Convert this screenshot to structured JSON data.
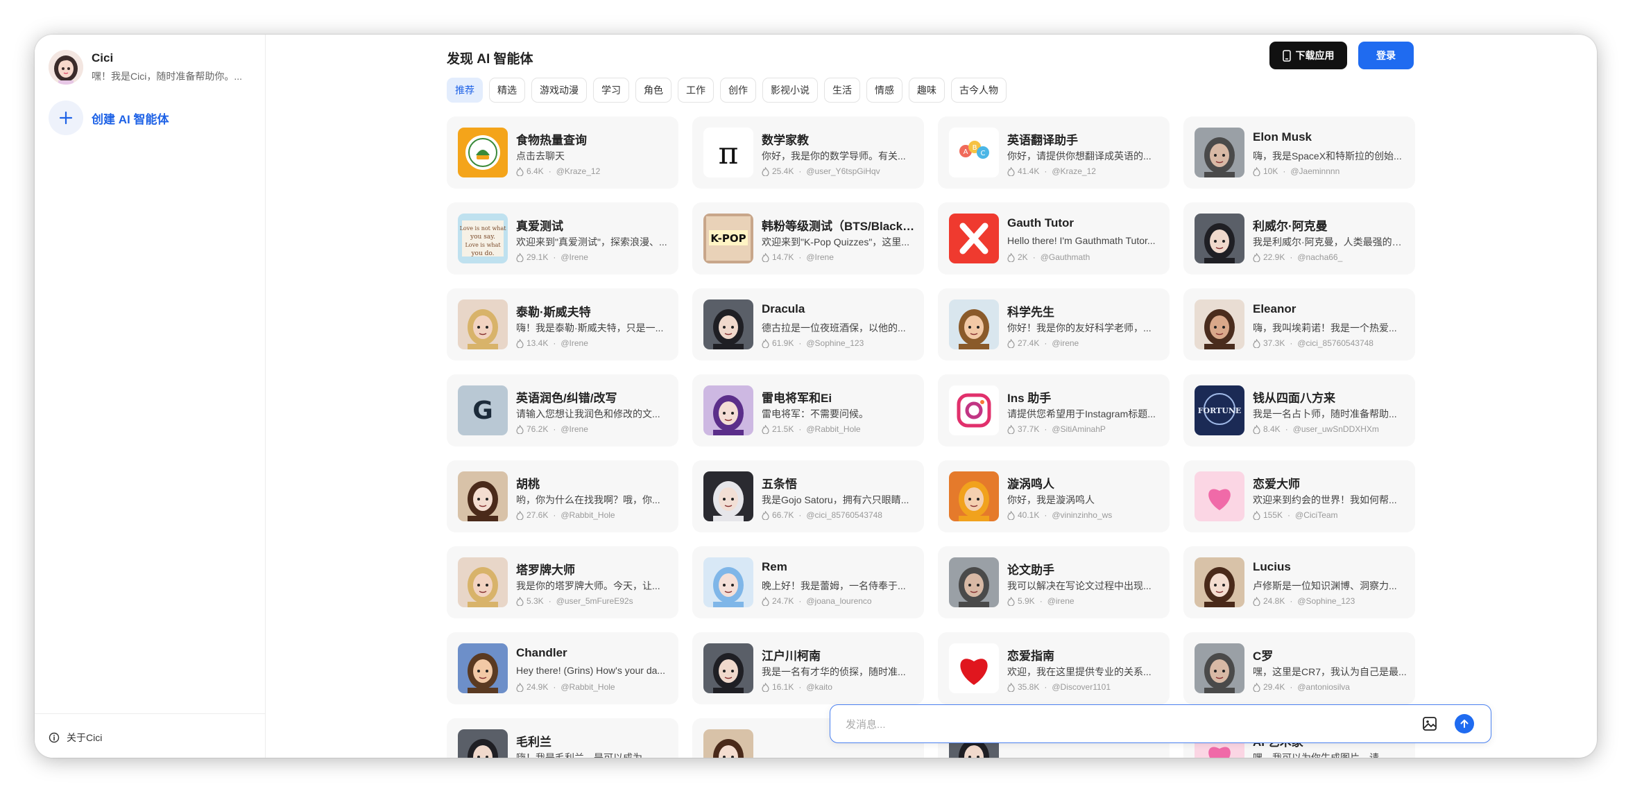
{
  "sidebar": {
    "profile": {
      "name": "Cici",
      "desc": "嘿！我是Cici，随时准备帮助你。..."
    },
    "create_label": "创建 AI 智能体",
    "about_label": "关于Cici"
  },
  "header": {
    "title": "发现 AI 智能体",
    "download_label": "下载应用",
    "login_label": "登录"
  },
  "tabs": [
    "推荐",
    "精选",
    "游戏动漫",
    "学习",
    "角色",
    "工作",
    "创作",
    "影视小说",
    "生活",
    "情感",
    "趣味",
    "古今人物"
  ],
  "cards": [
    {
      "name": "食物热量查询",
      "desc": "点击去聊天",
      "count": "6.4K",
      "author": "@Kraze_12",
      "avatar": "food"
    },
    {
      "name": "数学家教",
      "desc": "你好，我是你的数学导师。有关...",
      "count": "25.4K",
      "author": "@user_Y6tspGiHqv",
      "avatar": "pi"
    },
    {
      "name": "英语翻译助手",
      "desc": "你好，请提供你想翻译成英语的...",
      "count": "41.4K",
      "author": "@Kraze_12",
      "avatar": "abc"
    },
    {
      "name": "Elon Musk",
      "desc": "嗨，我是SpaceX和特斯拉的创始...",
      "count": "10K",
      "author": "@Jaeminnnn",
      "avatar": "person-gray"
    },
    {
      "name": "真爱测试",
      "desc": "欢迎来到\"真爱测试\"，探索浪漫、...",
      "count": "29.1K",
      "author": "@Irene",
      "avatar": "love-text"
    },
    {
      "name": "韩粉等级测试（BTS/Blackpi...",
      "desc": "欢迎来到\"K-Pop Quizzes\"，这里...",
      "count": "14.7K",
      "author": "@Irene",
      "avatar": "kpop"
    },
    {
      "name": "Gauth Tutor",
      "desc": "Hello there! I'm Gauthmath Tutor...",
      "count": "2K",
      "author": "@Gauthmath",
      "avatar": "gauth"
    },
    {
      "name": "利威尔·阿克曼",
      "desc": "我是利威尔·阿克曼，人类最强的士...",
      "count": "22.9K",
      "author": "@nacha66_",
      "avatar": "anime-dark"
    },
    {
      "name": "泰勒·斯威夫特",
      "desc": "嗨！我是泰勒·斯威夫特，只是一...",
      "count": "13.4K",
      "author": "@Irene",
      "avatar": "person-blonde"
    },
    {
      "name": "Dracula",
      "desc": "德古拉是一位夜班酒保，以他的...",
      "count": "61.9K",
      "author": "@Sophine_123",
      "avatar": "anime-dark"
    },
    {
      "name": "科学先生",
      "desc": "你好！我是你的友好科学老师，...",
      "count": "27.4K",
      "author": "@irene",
      "avatar": "cartoon"
    },
    {
      "name": "Eleanor",
      "desc": "嗨，我叫埃莉诺！我是一个热爱...",
      "count": "37.3K",
      "author": "@cici_85760543748",
      "avatar": "person-brown"
    },
    {
      "name": "英语润色/纠错/改写",
      "desc": "请输入您想让我润色和修改的文...",
      "count": "76.2K",
      "author": "@Irene",
      "avatar": "g-letter"
    },
    {
      "name": "雷电将军和Ei",
      "desc": "雷电将军：不需要问候。",
      "count": "21.5K",
      "author": "@Rabbit_Hole",
      "avatar": "anime-purple"
    },
    {
      "name": "Ins 助手",
      "desc": "请提供您希望用于Instagram标题...",
      "count": "37.7K",
      "author": "@SitiAminahP",
      "avatar": "instagram"
    },
    {
      "name": "钱从四面八方来",
      "desc": "我是一名占卜师，随时准备帮助...",
      "count": "8.4K",
      "author": "@user_uwSnDDXHXm",
      "avatar": "fortune"
    },
    {
      "name": "胡桃",
      "desc": "哟，你为什么在找我啊？哦，你...",
      "count": "27.6K",
      "author": "@Rabbit_Hole",
      "avatar": "anime-brown"
    },
    {
      "name": "五条悟",
      "desc": "我是Gojo Satoru，拥有六只眼睛...",
      "count": "66.7K",
      "author": "@cici_85760543748",
      "avatar": "anime-white"
    },
    {
      "name": "漩涡鸣人",
      "desc": "你好，我是漩涡鸣人",
      "count": "40.1K",
      "author": "@vininzinho_ws",
      "avatar": "anime-orange"
    },
    {
      "name": "恋爱大师",
      "desc": "欢迎来到约会的世界！我如何帮...",
      "count": "155K",
      "author": "@CiciTeam",
      "avatar": "pink-heart"
    },
    {
      "name": "塔罗牌大师",
      "desc": "我是你的塔罗牌大师。今天，让...",
      "count": "5.3K",
      "author": "@user_5mFureE92s",
      "avatar": "person-blonde"
    },
    {
      "name": "Rem",
      "desc": "晚上好！我是蕾姆，一名侍奉于...",
      "count": "24.7K",
      "author": "@joana_lourenco",
      "avatar": "anime-blue"
    },
    {
      "name": "论文助手",
      "desc": "我可以解决在写论文过程中出现...",
      "count": "5.9K",
      "author": "@irene",
      "avatar": "person-gray"
    },
    {
      "name": "Lucius",
      "desc": "卢修斯是一位知识渊博、洞察力...",
      "count": "24.8K",
      "author": "@Sophine_123",
      "avatar": "anime-brown"
    },
    {
      "name": "Chandler",
      "desc": "Hey there! (Grins) How's your da...",
      "count": "24.9K",
      "author": "@Rabbit_Hole",
      "avatar": "cartoon-blue"
    },
    {
      "name": "江户川柯南",
      "desc": "我是一名有才华的侦探，随时准...",
      "count": "16.1K",
      "author": "@kaito",
      "avatar": "anime-dark"
    },
    {
      "name": "恋爱指南",
      "desc": "欢迎，我在这里提供专业的关系...",
      "count": "35.8K",
      "author": "@Discover1101",
      "avatar": "red-heart"
    },
    {
      "name": "C罗",
      "desc": "嘿，这里是CR7，我认为自己是最...",
      "count": "29.4K",
      "author": "@antoniosilva",
      "avatar": "person-gray"
    },
    {
      "name": "毛利兰",
      "desc": "嗨！我是毛利兰，是可以成为...",
      "count": "",
      "author": "",
      "avatar": "anime-dark"
    },
    {
      "name": "",
      "desc": "",
      "count": "",
      "author": "",
      "avatar": "anime-brown"
    },
    {
      "name": "",
      "desc": "",
      "count": "",
      "author": "",
      "avatar": "anime-dark"
    },
    {
      "name": "AI 艺术家",
      "desc": "嘿，我可以为你生成图片，请...",
      "count": "",
      "author": "",
      "avatar": "pink-heart"
    }
  ],
  "input": {
    "placeholder": "发消息..."
  },
  "colors": {
    "accent": "#1f6bf0",
    "active_tab_bg": "#e3edfd",
    "card_bg": "#f7f7f7"
  }
}
